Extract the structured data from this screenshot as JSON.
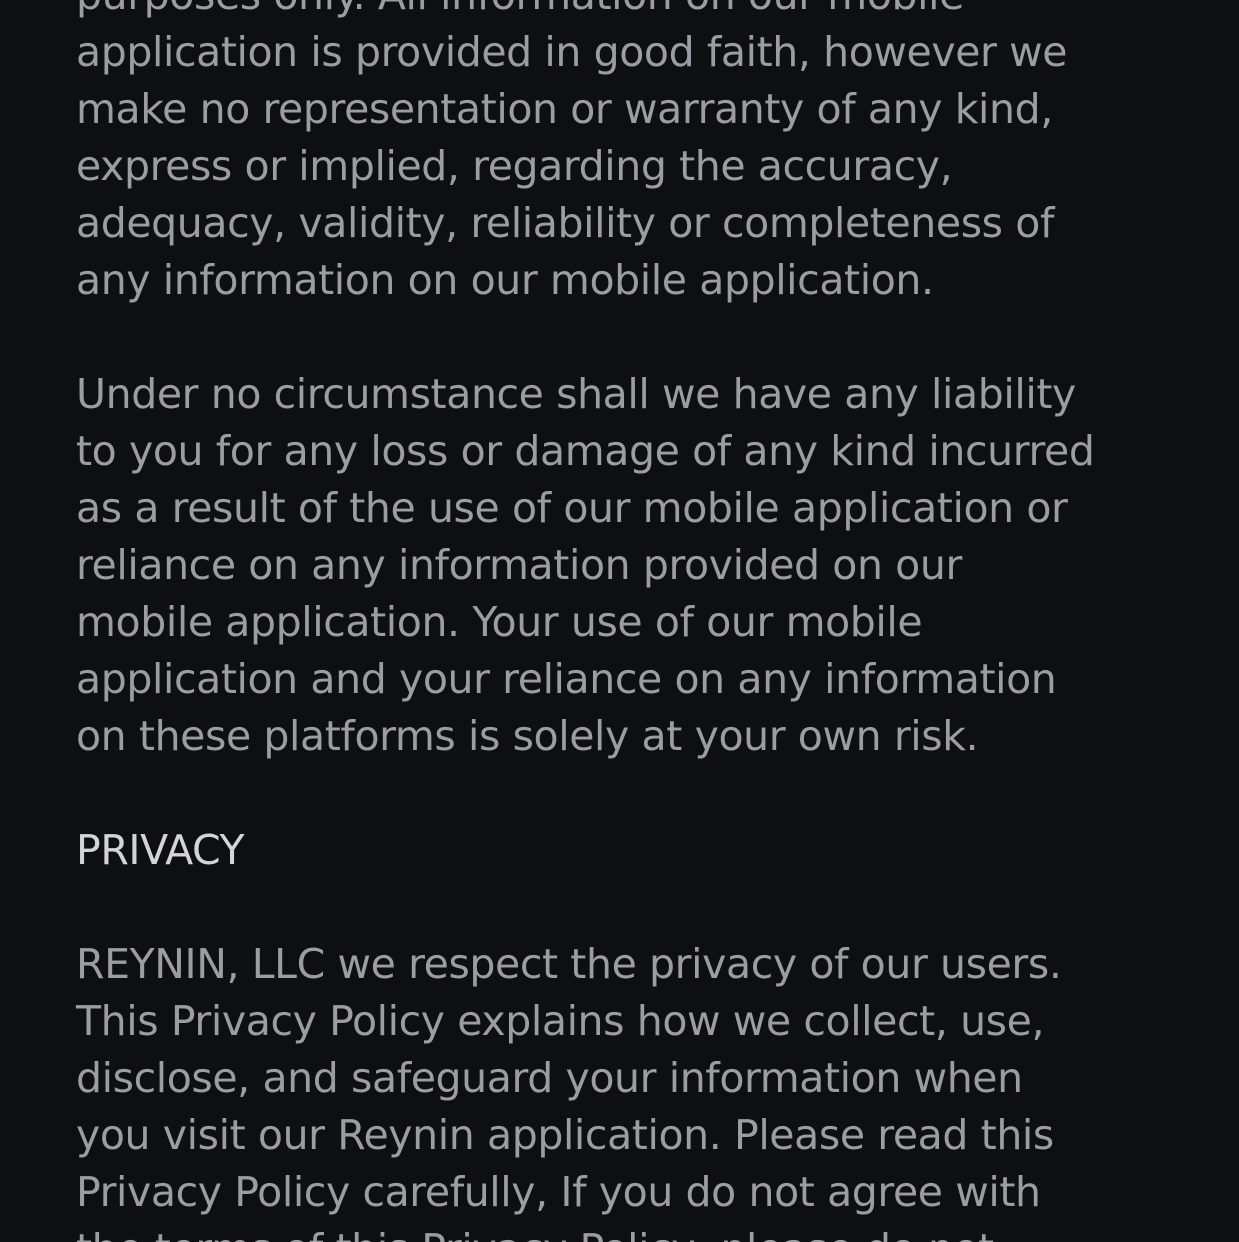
{
  "disclaimer": {
    "paragraph_1_lines": [
      "purposes only. All information on our mobile",
      "application is provided in good faith, however we",
      "make no representation or warranty of any kind,",
      "express or implied, regarding the accuracy,",
      "adequacy, validity, reliability or completeness of",
      "any information on our mobile application."
    ],
    "paragraph_2_lines": [
      "Under no circumstance shall we have any liability",
      "to you for any loss or damage of any kind incurred",
      "as a result of the use of our mobile application or",
      "reliance on any information provided on our",
      "mobile application. Your use of our mobile",
      "application and your reliance on any information",
      "on these platforms is solely at your own risk."
    ]
  },
  "privacy": {
    "heading": "PRIVACY",
    "paragraph_lines": [
      "REYNIN, LLC we respect the privacy of our users.",
      "This Privacy Policy explains how we collect, use,",
      "disclose, and safeguard your information when",
      "you visit our Reynin application. Please read this",
      "Privacy Policy carefully, If you do not agree with",
      "the terms of this Privacy Policy, please do not"
    ]
  },
  "colors": {
    "background": "#0e0f11",
    "body_text": "#9c9ca1",
    "heading_text": "#d4d4d8"
  }
}
